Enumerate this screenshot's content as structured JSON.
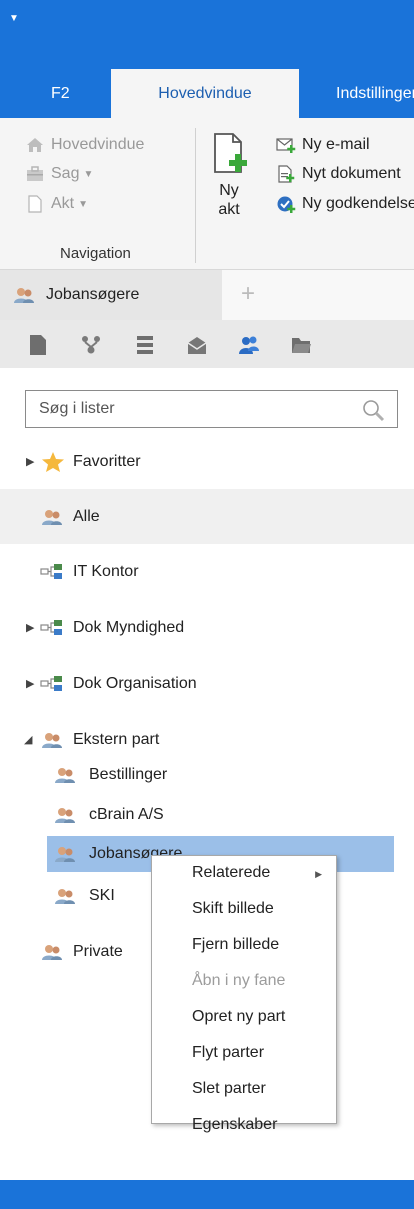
{
  "ribbon_tabs": [
    "F2",
    "Hovedvindue",
    "Indstillinger"
  ],
  "ribbon": {
    "nav_items": [
      "Hovedvindue",
      "Sag",
      "Akt"
    ],
    "group_label": "Navigation",
    "big_button": {
      "line1": "Ny",
      "line2": "akt"
    },
    "new_items": [
      "Ny e-mail",
      "Nyt dokument",
      "Ny godkendelse"
    ]
  },
  "doc_tab": {
    "label": "Jobansøgere",
    "add_glyph": "+"
  },
  "toolbar_icons": [
    "document-icon",
    "organization-icon",
    "list-icon",
    "mail-icon",
    "people-icon",
    "folder-icon"
  ],
  "search": {
    "placeholder": "Søg i lister"
  },
  "tree": {
    "favorites": "Favoritter",
    "all": "Alle",
    "it_office": "IT Kontor",
    "dok_authority": "Dok Myndighed",
    "dok_organisation": "Dok Organisation",
    "external": "Ekstern part",
    "external_children": [
      "Bestillinger",
      "cBrain A/S",
      "Jobansøgere",
      "SKI"
    ],
    "private": "Private"
  },
  "context_menu": {
    "items": [
      "Relaterede",
      "Skift billede",
      "Fjern billede",
      "Åbn i ny fane",
      "Opret ny part",
      "Flyt parter",
      "Slet parter",
      "Egenskaber"
    ],
    "disabled_index": 3
  },
  "colors": {
    "accent": "#1a73d9",
    "selection": "#9bbfe8",
    "tab_text": "#1d5fb0"
  }
}
